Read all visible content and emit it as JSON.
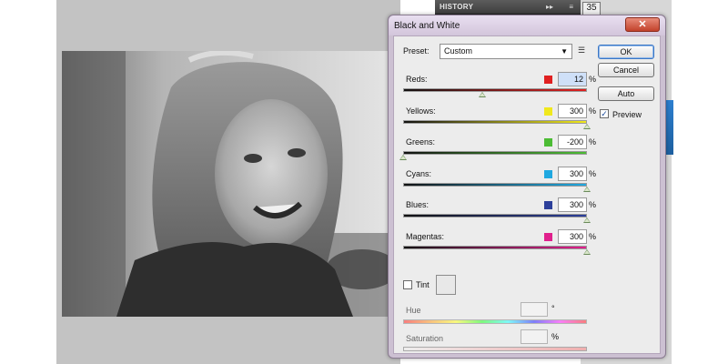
{
  "history_panel": {
    "title": "HISTORY",
    "arrows": "▸▸",
    "menu": "≡",
    "counter": "35"
  },
  "dialog": {
    "title": "Black and White",
    "close": "✕",
    "preset_label": "Preset:",
    "preset_value": "Custom",
    "buttons": {
      "ok": "OK",
      "cancel": "Cancel",
      "auto": "Auto"
    },
    "preview_label": "Preview",
    "preview_checked": true,
    "channels": [
      {
        "label": "Reds:",
        "value": "12",
        "color": "#e02020",
        "pct": "%",
        "slider_fraction": 0.43
      },
      {
        "label": "Yellows:",
        "value": "300",
        "color": "#f0e81c",
        "pct": "%",
        "slider_fraction": 1.0
      },
      {
        "label": "Greens:",
        "value": "-200",
        "color": "#4cbc34",
        "pct": "%",
        "slider_fraction": 0.0
      },
      {
        "label": "Cyans:",
        "value": "300",
        "color": "#20a8e0",
        "pct": "%",
        "slider_fraction": 1.0
      },
      {
        "label": "Blues:",
        "value": "300",
        "color": "#2c3f9a",
        "pct": "%",
        "slider_fraction": 1.0
      },
      {
        "label": "Magentas:",
        "value": "300",
        "color": "#e0208c",
        "pct": "%",
        "slider_fraction": 1.0
      }
    ],
    "tint": {
      "label": "Tint",
      "checked": false
    },
    "hue": {
      "label": "Hue",
      "unit": "°"
    },
    "saturation": {
      "label": "Saturation",
      "unit": "%"
    }
  },
  "colors": {
    "dialog_frame": "#ccc0d2",
    "client_bg": "#ececec",
    "close_button": "#c2422b",
    "workspace": "#c3c3c3"
  }
}
